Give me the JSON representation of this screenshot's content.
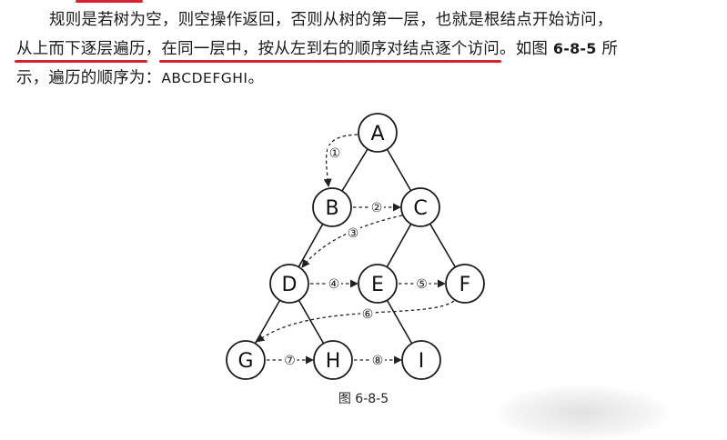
{
  "paragraph": {
    "line1": {
      "text": "规则是若树为空，则空操作返回，否则从树的第一层，也就是根结点开始访问，"
    },
    "line2": {
      "highlight1": "从上而下逐层遍历",
      "sep1": "，",
      "highlight2": "在同一层中，按从左到右的顺序对结点逐个访问",
      "sep2": "。如图 ",
      "figure_ref": "6-8-5",
      "tail": " 所"
    },
    "line3": {
      "text": "示，遍历的顺序为：",
      "sequence": "ABCDEFGHI",
      "end": "。"
    }
  },
  "diagram": {
    "nodes": [
      {
        "id": "A",
        "label": "A"
      },
      {
        "id": "B",
        "label": "B"
      },
      {
        "id": "C",
        "label": "C"
      },
      {
        "id": "D",
        "label": "D"
      },
      {
        "id": "E",
        "label": "E"
      },
      {
        "id": "F",
        "label": "F"
      },
      {
        "id": "G",
        "label": "G"
      },
      {
        "id": "H",
        "label": "H"
      },
      {
        "id": "I",
        "label": "I"
      }
    ],
    "edges": [
      [
        "A",
        "B"
      ],
      [
        "A",
        "C"
      ],
      [
        "B",
        "D"
      ],
      [
        "C",
        "E"
      ],
      [
        "C",
        "F"
      ],
      [
        "D",
        "G"
      ],
      [
        "D",
        "H"
      ],
      [
        "E",
        "I"
      ]
    ],
    "traversal": [
      {
        "from": "A",
        "to": "B",
        "label": "①"
      },
      {
        "from": "B",
        "to": "C",
        "label": "②"
      },
      {
        "from": "C",
        "to": "D",
        "label": "③"
      },
      {
        "from": "D",
        "to": "E",
        "label": "④"
      },
      {
        "from": "E",
        "to": "F",
        "label": "⑤"
      },
      {
        "from": "F",
        "to": "G",
        "label": "⑥"
      },
      {
        "from": "G",
        "to": "H",
        "label": "⑦"
      },
      {
        "from": "H",
        "to": "I",
        "label": "⑧"
      }
    ]
  },
  "caption": "图 6-8-5"
}
